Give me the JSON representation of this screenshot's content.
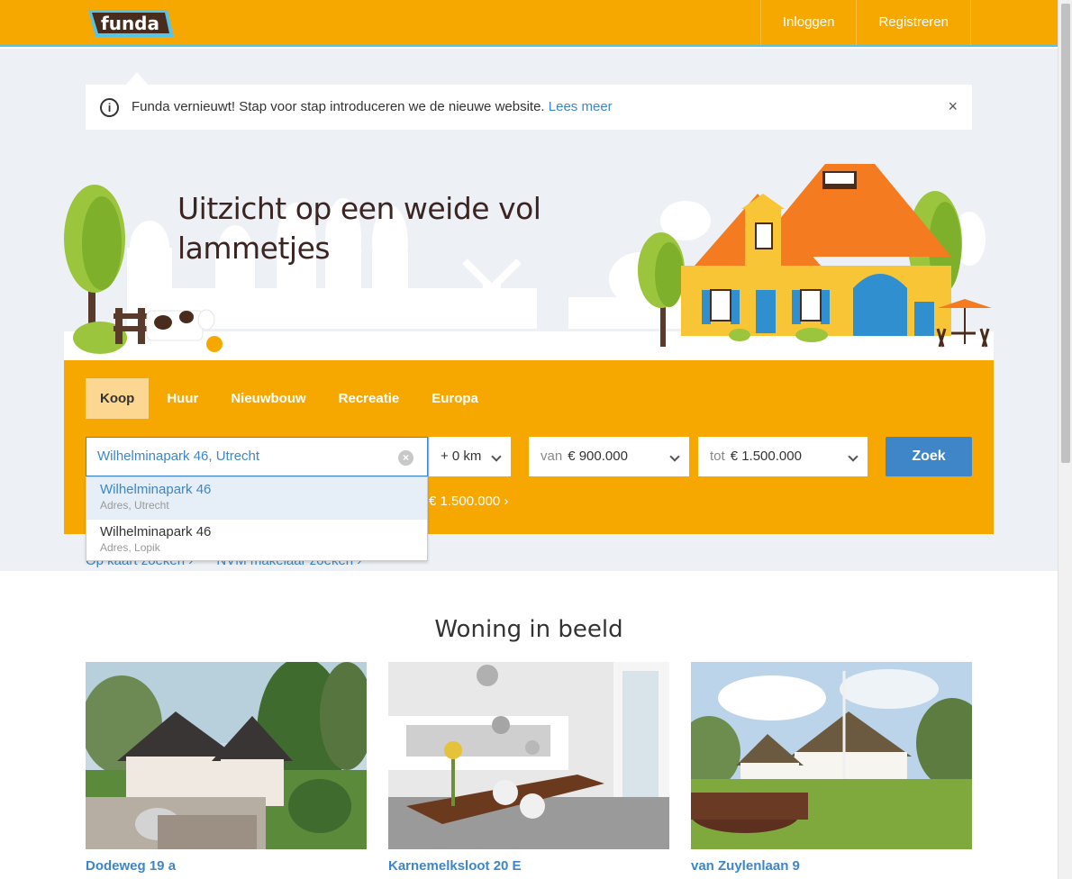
{
  "header": {
    "logo_text": "funda",
    "nav": [
      "Inloggen",
      "Registreren"
    ]
  },
  "notice": {
    "message": "Funda vernieuwt! Stap voor stap introduceren we de nieuwe website.",
    "link": "Lees meer",
    "close": "×"
  },
  "hero": {
    "title": "Uitzicht op een weide vol lammetjes"
  },
  "search": {
    "tabs": [
      "Koop",
      "Huur",
      "Nieuwbouw",
      "Recreatie",
      "Europa"
    ],
    "active_tab": "Koop",
    "query": "Wilhelminapark 46, Utrecht",
    "radius": "+ 0 km",
    "price_from_label": "van",
    "price_from": "€ 900.000",
    "price_to_label": "tot",
    "price_to": "€ 1.500.000",
    "submit": "Zoek",
    "last_search_tail": "€ 1.500.000 ›"
  },
  "autocomplete": [
    {
      "title": "Wilhelminapark 46",
      "sub": "Adres, Utrecht"
    },
    {
      "title": "Wilhelminapark 46",
      "sub": "Adres, Lopik"
    }
  ],
  "sublinks": [
    "Op kaart zoeken ›",
    "NVM makelaar zoeken ›"
  ],
  "woning_in_beeld": {
    "title": "Woning in beeld",
    "cards": [
      {
        "caption": "Dodeweg 19 a"
      },
      {
        "caption": "Karnemelksloot 20 E"
      },
      {
        "caption": "van Zuylenlaan 9"
      }
    ]
  },
  "colors": {
    "brand_orange": "#f7a800",
    "link_blue": "#3e86c7",
    "accent_cyan": "#54c4e8"
  }
}
